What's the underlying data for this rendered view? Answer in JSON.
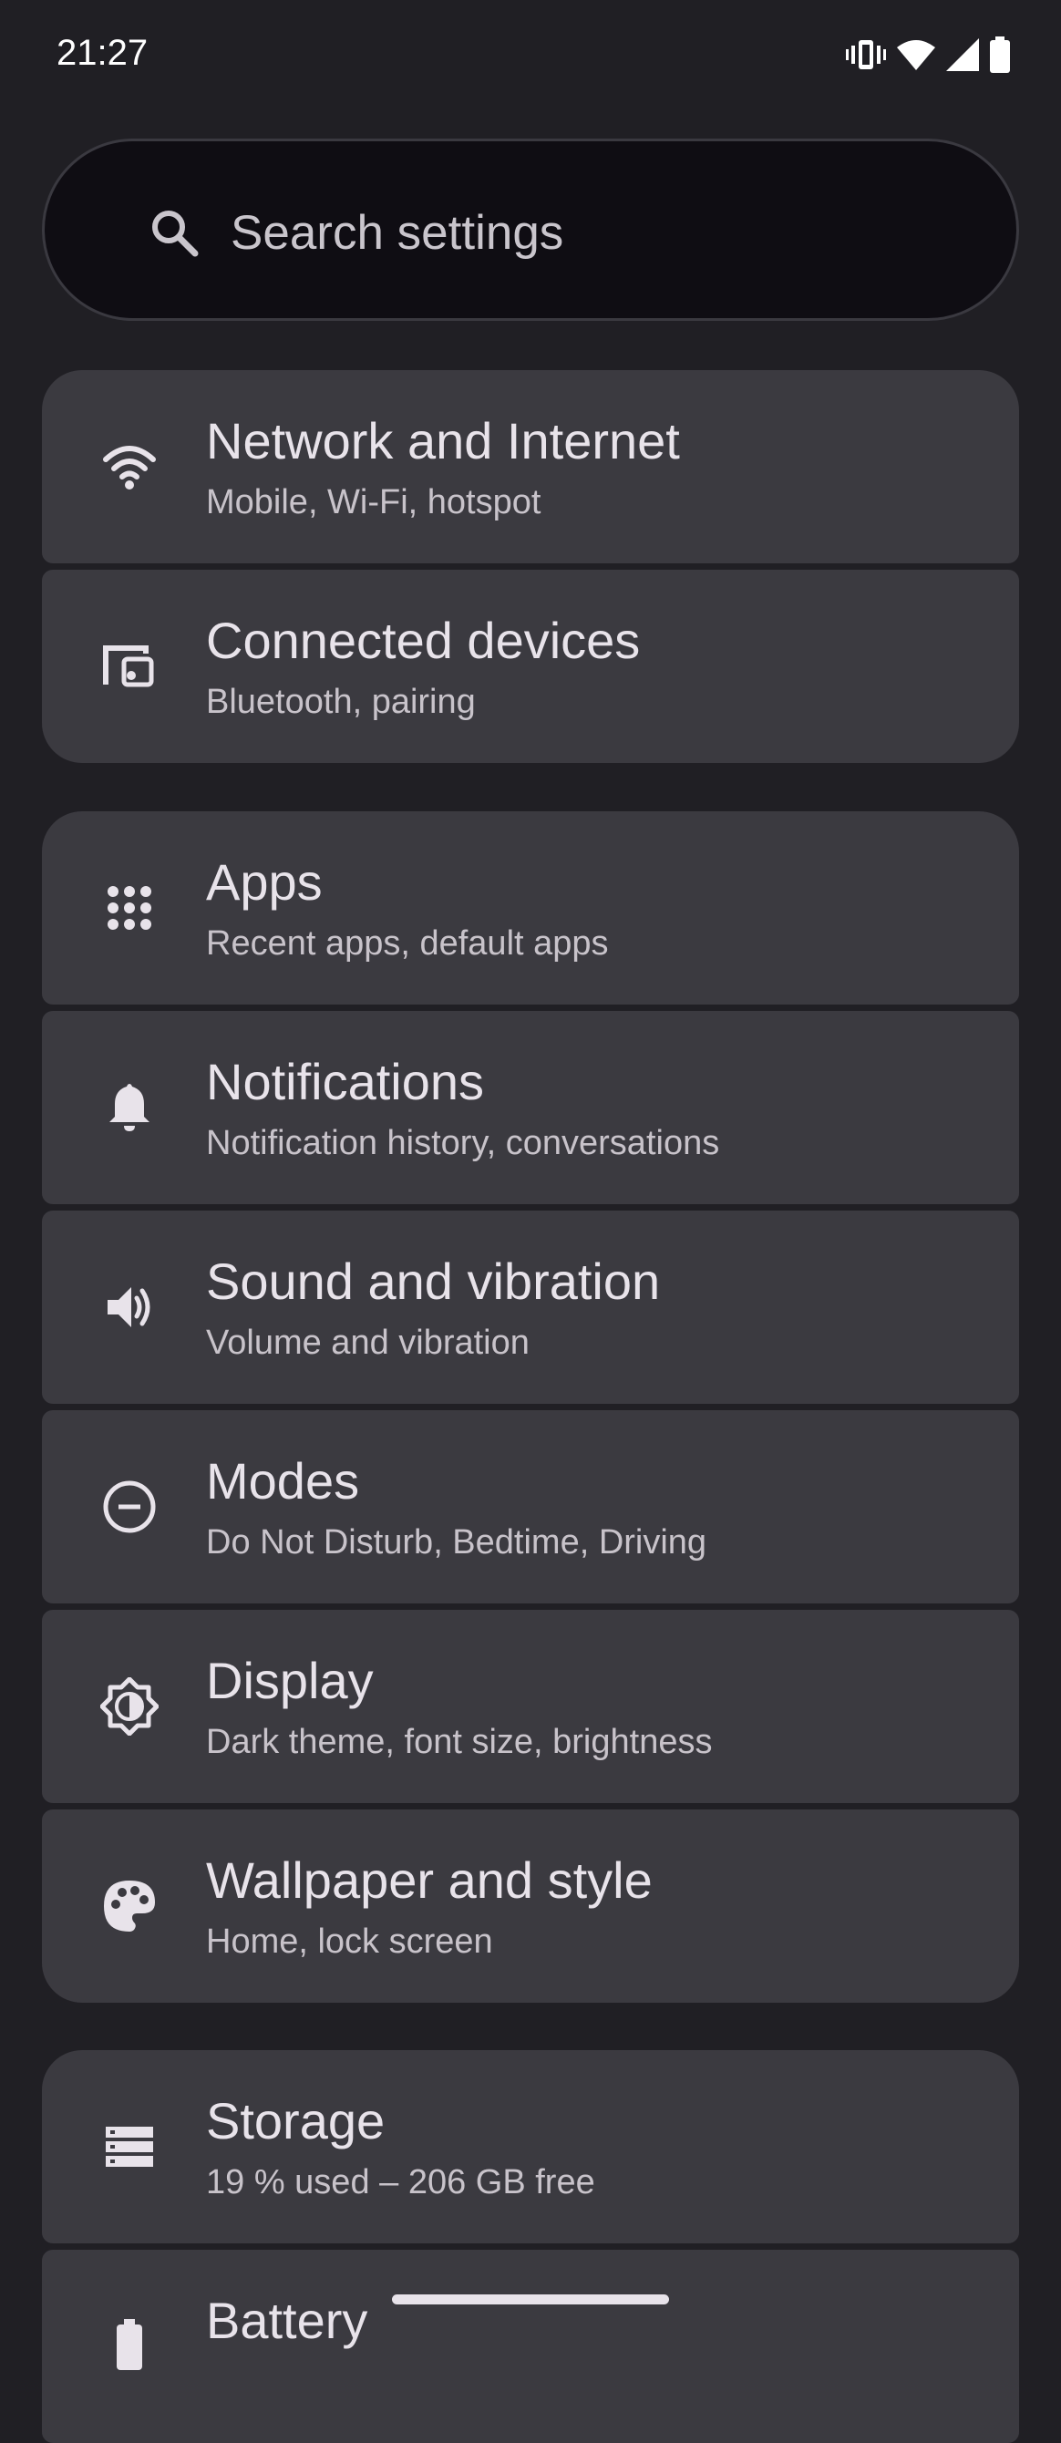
{
  "status_bar": {
    "time": "21:27"
  },
  "search": {
    "placeholder": "Search settings"
  },
  "groups": [
    {
      "items": [
        {
          "title": "Network and Internet",
          "subtitle": "Mobile, Wi-Fi, hotspot",
          "icon": "wifi-icon"
        },
        {
          "title": "Connected devices",
          "subtitle": "Bluetooth, pairing",
          "icon": "devices-icon"
        }
      ]
    },
    {
      "items": [
        {
          "title": "Apps",
          "subtitle": "Recent apps, default apps",
          "icon": "apps-grid-icon"
        },
        {
          "title": "Notifications",
          "subtitle": "Notification history, conversations",
          "icon": "bell-icon"
        },
        {
          "title": "Sound and vibration",
          "subtitle": "Volume and vibration",
          "icon": "speaker-icon"
        },
        {
          "title": "Modes",
          "subtitle": "Do Not Disturb, Bedtime, Driving",
          "icon": "do-not-disturb-icon"
        },
        {
          "title": "Display",
          "subtitle": "Dark theme, font size, brightness",
          "icon": "brightness-icon"
        },
        {
          "title": "Wallpaper and style",
          "subtitle": "Home, lock screen",
          "icon": "palette-icon"
        }
      ]
    },
    {
      "items": [
        {
          "title": "Storage",
          "subtitle": "19 % used – 206 GB free",
          "icon": "storage-icon"
        },
        {
          "title": "Battery",
          "subtitle": "",
          "icon": "battery-icon"
        }
      ]
    }
  ],
  "colors": {
    "background": "#201f24",
    "card": "#3b3a40",
    "search_background": "#0f0d13",
    "text_primary": "#e8e3ea",
    "text_secondary": "#c8c3ca"
  }
}
